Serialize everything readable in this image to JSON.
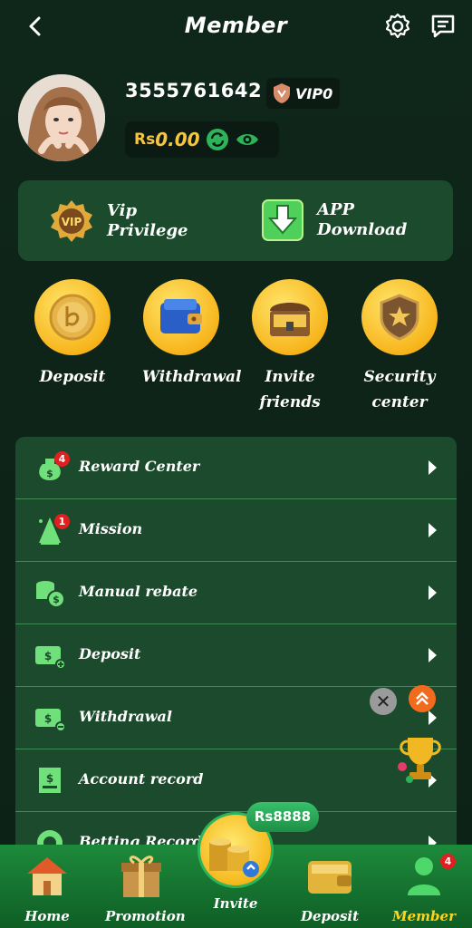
{
  "header": {
    "title": "Member"
  },
  "profile": {
    "user_id": "3555761642",
    "vip_level": "VIP0",
    "currency": "Rs",
    "balance": "0.00"
  },
  "feature_panel": {
    "vip": {
      "line1": "Vip",
      "line2": "Privilege"
    },
    "app": {
      "line1": "APP",
      "line2": "Download"
    }
  },
  "quick_actions": [
    {
      "line1": "Deposit",
      "line2": ""
    },
    {
      "line1": "Withdrawal",
      "line2": ""
    },
    {
      "line1": "Invite",
      "line2": "friends"
    },
    {
      "line1": "Security",
      "line2": "center"
    }
  ],
  "menu": [
    {
      "label": "Reward Center",
      "badge": "4"
    },
    {
      "label": "Mission",
      "badge": "1"
    },
    {
      "label": "Manual rebate",
      "badge": ""
    },
    {
      "label": "Deposit",
      "badge": ""
    },
    {
      "label": "Withdrawal",
      "badge": ""
    },
    {
      "label": "Account record",
      "badge": ""
    },
    {
      "label": "Betting Record",
      "badge": ""
    }
  ],
  "invite_promo": {
    "amount": "Rs8888"
  },
  "nav": {
    "items": [
      "Home",
      "Promotion",
      "Invite",
      "Deposit",
      "Member"
    ],
    "member_badge": "4",
    "active": "Member"
  },
  "colors": {
    "accent_gold": "#f5c544",
    "active_nav": "#ffd21e",
    "panel_green": "#1c4a2c"
  }
}
